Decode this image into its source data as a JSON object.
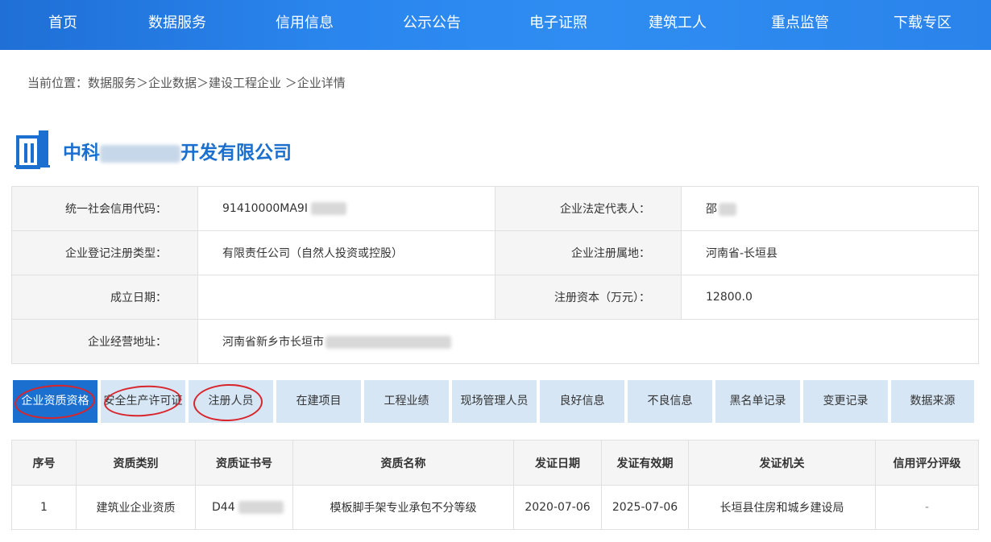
{
  "nav": {
    "items": [
      "首页",
      "数据服务",
      "信用信息",
      "公示公告",
      "电子证照",
      "建筑工人",
      "重点监管",
      "下载专区"
    ]
  },
  "breadcrumb": "当前位置：数据服务＞企业数据＞建设工程企业 ＞企业详情",
  "company": {
    "name_prefix": "中科",
    "name_suffix": "开发有限公司",
    "icon": "building-icon"
  },
  "info": {
    "credit_code_label": "统一社会信用代码：",
    "credit_code_value": "91410000MA9I",
    "legal_rep_label": "企业法定代表人：",
    "legal_rep_value": "邵",
    "reg_type_label": "企业登记注册类型：",
    "reg_type_value": "有限责任公司（自然人投资或控股）",
    "reg_location_label": "企业注册属地：",
    "reg_location_value": "河南省-长垣县",
    "founded_label": "成立日期：",
    "founded_value": "",
    "capital_label": "注册资本（万元）：",
    "capital_value": "12800.0",
    "address_label": "企业经营地址：",
    "address_value": "河南省新乡市长垣市"
  },
  "tabs": [
    "企业资质资格",
    "安全生产许可证",
    "注册人员",
    "在建项目",
    "工程业绩",
    "现场管理人员",
    "良好信息",
    "不良信息",
    "黑名单记录",
    "变更记录",
    "数据来源"
  ],
  "active_tab": "企业资质资格",
  "qualifications": {
    "headers": [
      "序号",
      "资质类别",
      "资质证书号",
      "资质名称",
      "发证日期",
      "发证有效期",
      "发证机关",
      "信用评分评级"
    ],
    "rows": [
      [
        "1",
        "建筑业企业资质",
        "D44",
        "模板脚手架专业承包不分等级",
        "2020-07-06",
        "2025-07-06",
        "长垣县住房和城乡建设局",
        "-"
      ]
    ]
  },
  "colors": {
    "nav_blue": "#2a86ee",
    "brand_blue": "#1b6fcf",
    "tab_bg": "#d6e6f5",
    "annotation_red": "#d8242a"
  }
}
